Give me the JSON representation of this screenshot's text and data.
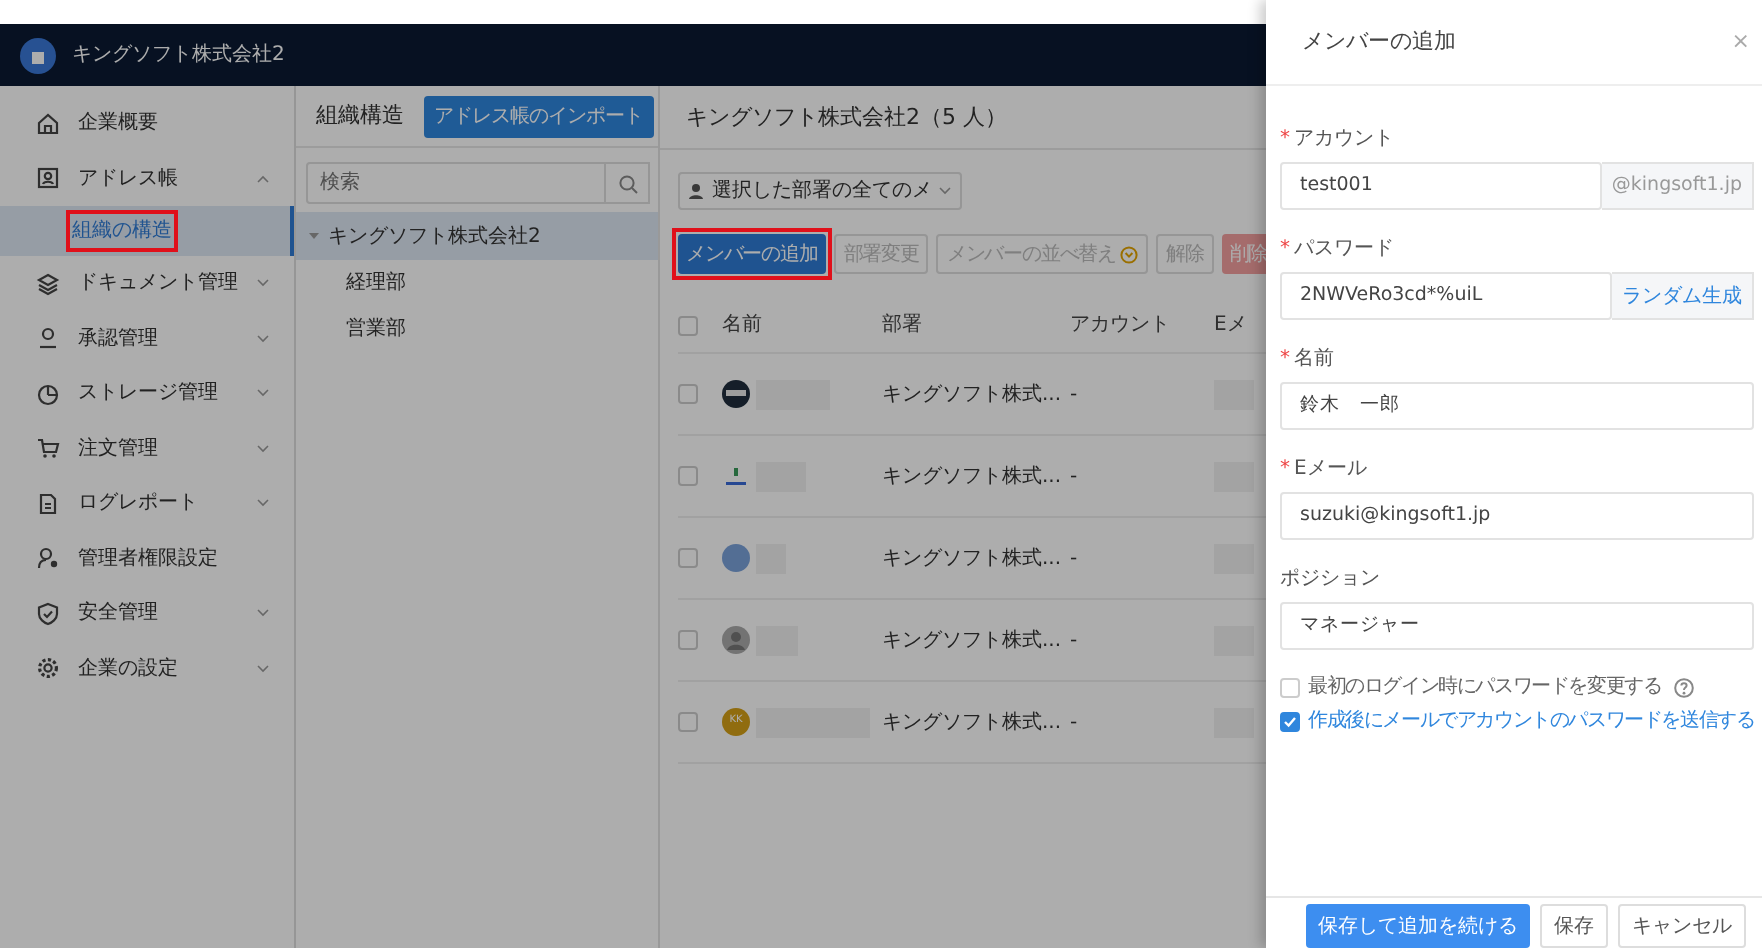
{
  "header": {
    "company": "キングソフト株式会社2"
  },
  "sidebar": {
    "items": [
      {
        "label": "企業概要"
      },
      {
        "label": "アドレス帳",
        "expanded": true,
        "children": [
          {
            "label": "組織の構造",
            "selected": true,
            "highlighted": true
          }
        ]
      },
      {
        "label": "ドキュメント管理",
        "expanded": false
      },
      {
        "label": "承認管理",
        "expanded": false
      },
      {
        "label": "ストレージ管理",
        "expanded": false
      },
      {
        "label": "注文管理",
        "expanded": false
      },
      {
        "label": "ログレポート",
        "expanded": false
      },
      {
        "label": "管理者権限設定"
      },
      {
        "label": "安全管理",
        "expanded": false
      },
      {
        "label": "企業の設定",
        "expanded": false
      }
    ]
  },
  "org_panel": {
    "title": "組織構造",
    "import_button": "アドレス帳のインポート",
    "search": {
      "placeholder": "検索"
    },
    "tree": [
      {
        "label": "キングソフト株式会社2",
        "expanded": true,
        "selected": true,
        "children": [
          {
            "label": "経理部",
            "selected": false
          },
          {
            "label": "営業部",
            "selected": false
          }
        ]
      }
    ]
  },
  "main": {
    "title": "キングソフト株式会社2（5 人）",
    "filter": "選択した部署の全てのメ",
    "buttons": [
      {
        "label": "メンバーの追加",
        "kind": "primary",
        "highlighted": true,
        "disabled": false
      },
      {
        "label": "部署変更",
        "kind": "default",
        "highlighted": false,
        "disabled": true
      },
      {
        "label": "メンバーの並べ替え",
        "kind": "sort",
        "highlighted": false,
        "disabled": true
      },
      {
        "label": "解除",
        "kind": "default",
        "highlighted": false,
        "disabled": true
      },
      {
        "label": "削除",
        "kind": "danger",
        "highlighted": false,
        "disabled": true
      }
    ],
    "table": {
      "all_checked": false,
      "columns": [
        "名前",
        "部署",
        "アカウント",
        "Eメ"
      ],
      "rows": [
        {
          "avatar": {
            "kind": "emblem"
          },
          "department": "キングソフト株式...",
          "account": "-",
          "checked": false
        },
        {
          "avatar": {
            "kind": "logo"
          },
          "department": "キングソフト株式...",
          "account": "-",
          "checked": false
        },
        {
          "avatar": {
            "kind": "plain"
          },
          "department": "キングソフト株式...",
          "account": "-",
          "checked": false
        },
        {
          "avatar": {
            "kind": "person"
          },
          "department": "キングソフト株式...",
          "account": "-",
          "checked": false
        },
        {
          "avatar": {
            "kind": "initials",
            "initials": "KK"
          },
          "department": "キングソフト株式...",
          "account": "-",
          "checked": false
        }
      ]
    }
  },
  "drawer": {
    "title": "メンバーの追加",
    "close": "×",
    "fields": [
      {
        "label": "アカウント",
        "required_mark": "*",
        "value": "test001",
        "addon": {
          "text": "@kingsoft1.jp",
          "kind": "suffix"
        }
      },
      {
        "label": "パスワード",
        "required_mark": "*",
        "value": "2NWVeRo3cd*%uiL",
        "addon": {
          "text": "ランダム生成",
          "kind": "link"
        }
      },
      {
        "label": "名前",
        "required_mark": "*",
        "value": "鈴木　一郎"
      },
      {
        "label": "Eメール",
        "required_mark": "*",
        "value": "suzuki@kingsoft1.jp"
      },
      {
        "label": "ポジション",
        "value": "マネージャー"
      }
    ],
    "checkboxes": [
      {
        "label": "最初のログイン時にパスワードを変更する",
        "checked": false,
        "help": true
      },
      {
        "label": "作成後にメールでアカウントのパスワードを送信する",
        "checked": true
      }
    ],
    "buttons": [
      {
        "label": "保存して追加を続ける",
        "kind": "primary"
      },
      {
        "label": "保存",
        "kind": "default"
      },
      {
        "label": "キャンセル",
        "kind": "default"
      }
    ]
  }
}
